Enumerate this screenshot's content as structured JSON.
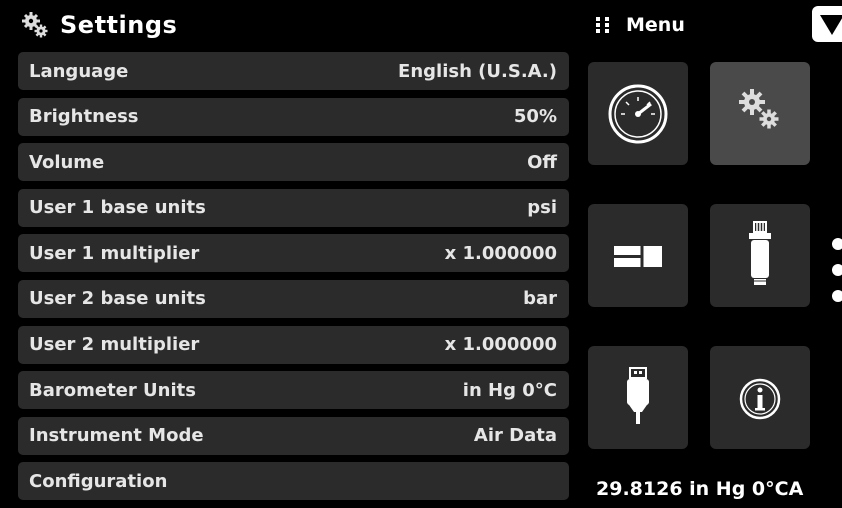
{
  "header": {
    "title": "Settings",
    "icon": "gears-icon"
  },
  "menu": {
    "title": "Menu",
    "dropdown_icon": "triangle-down-icon"
  },
  "settings": [
    {
      "label": "Language",
      "value": "English (U.S.A.)"
    },
    {
      "label": "Brightness",
      "value": "50%"
    },
    {
      "label": "Volume",
      "value": "Off"
    },
    {
      "label": "User 1 base units",
      "value": "psi"
    },
    {
      "label": "User 1 multiplier",
      "value": "x 1.000000"
    },
    {
      "label": "User 2 base units",
      "value": "bar"
    },
    {
      "label": "User 2 multiplier",
      "value": "x 1.000000"
    },
    {
      "label": "Barometer Units",
      "value": "in Hg 0°C"
    },
    {
      "label": "Instrument Mode",
      "value": "Air Data"
    },
    {
      "label": "Configuration",
      "value": ""
    }
  ],
  "tiles": [
    {
      "icon": "gauge-icon",
      "selected": false
    },
    {
      "icon": "gears-icon",
      "selected": true
    },
    {
      "icon": "split-window-icon",
      "selected": false
    },
    {
      "icon": "transducer-icon",
      "selected": false
    },
    {
      "icon": "usb-icon",
      "selected": false
    },
    {
      "icon": "info-icon",
      "selected": false
    }
  ],
  "barometer_reading": "29.8126 in Hg 0°CA",
  "colors": {
    "background": "#000000",
    "row": "#2b2b2b",
    "tile_selected": "#4a4a4a"
  }
}
